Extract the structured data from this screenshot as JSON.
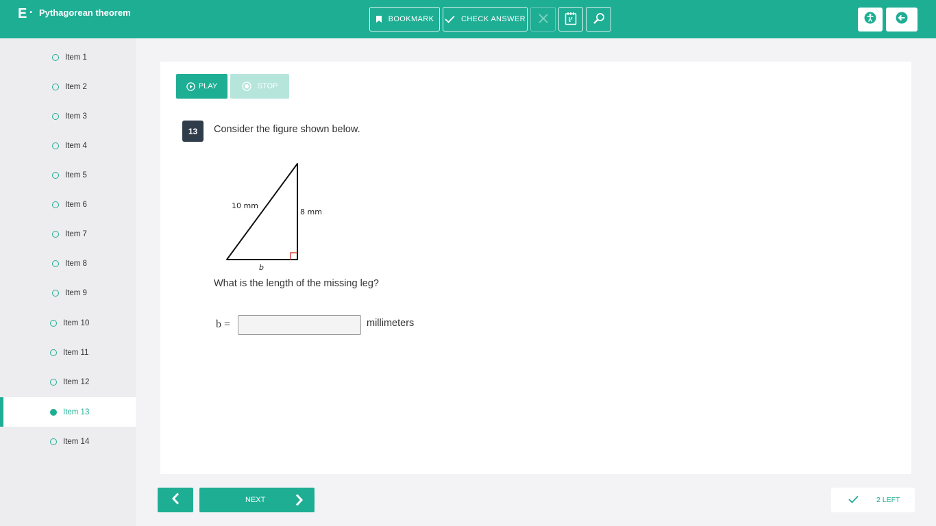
{
  "header": {
    "logo": "E",
    "title": "Pythagorean theorem",
    "bookmark_label": "BOOKMARK",
    "check_answer_label": "CHECK ANSWER",
    "icons": [
      "bookmark-icon",
      "check-icon",
      "close-icon",
      "notepad-icon",
      "magnifier-icon",
      "accessibility-icon",
      "exit-arrow-icon"
    ]
  },
  "sidebar": {
    "items": [
      {
        "label": "Item 1",
        "active": false
      },
      {
        "label": "Item 2",
        "active": false
      },
      {
        "label": "Item 3",
        "active": false
      },
      {
        "label": "Item 4",
        "active": false
      },
      {
        "label": "Item 5",
        "active": false
      },
      {
        "label": "Item 6",
        "active": false
      },
      {
        "label": "Item 7",
        "active": false
      },
      {
        "label": "Item 8",
        "active": false
      },
      {
        "label": "Item 9",
        "active": false
      },
      {
        "label": "Item 10",
        "active": false
      },
      {
        "label": "Item 11",
        "active": false
      },
      {
        "label": "Item 12",
        "active": false
      },
      {
        "label": "Item 13",
        "active": true
      },
      {
        "label": "Item 14",
        "active": false
      }
    ]
  },
  "audio": {
    "play_label": "PLAY",
    "stop_label": "STOP"
  },
  "question": {
    "number": "13",
    "prompt": "Consider the figure shown below.",
    "figure": {
      "hypotenuse_label": "10 mm",
      "leg_label": "8 mm",
      "base_label": "b"
    },
    "sub_prompt": "What is the length of the missing leg?",
    "answer_label": "b =",
    "answer_value": "",
    "answer_unit": "millimeters"
  },
  "footer": {
    "next_label": "NEXT",
    "remaining_label": "2 LEFT"
  },
  "colors": {
    "accent": "#1eae94",
    "accent_light": "#b6e5dc",
    "badge": "#2f3c4a",
    "right_angle": "#e0443c"
  }
}
